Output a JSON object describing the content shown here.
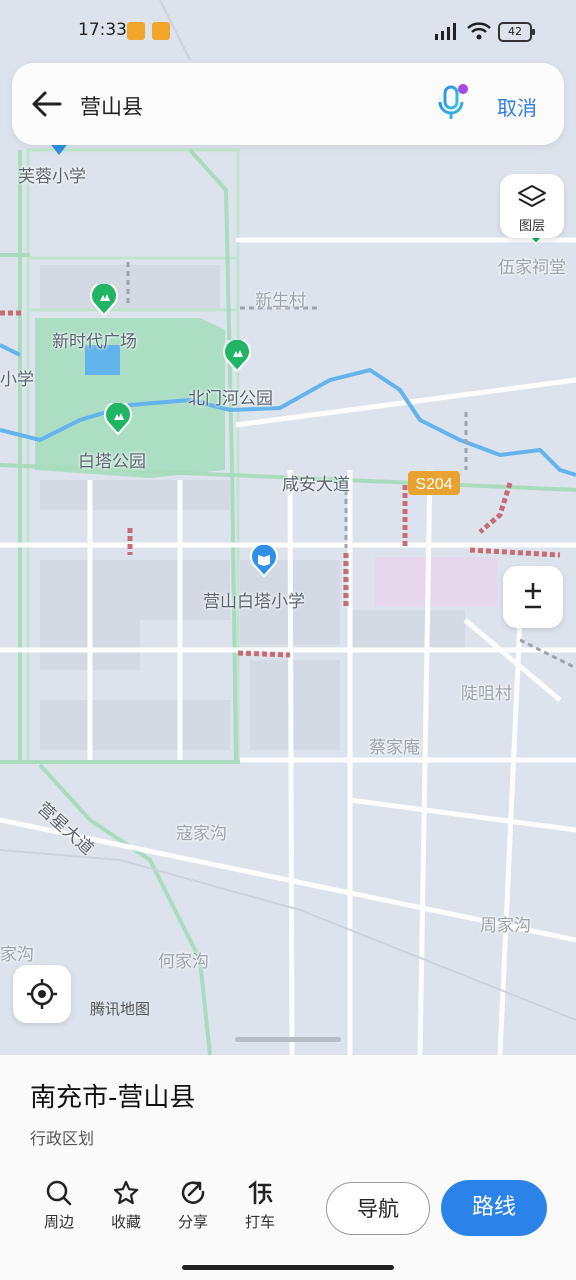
{
  "status_bar": {
    "time": "17:33",
    "battery": "42"
  },
  "search": {
    "query": "营山县",
    "cancel_label": "取消"
  },
  "map": {
    "labels": [
      {
        "text": "芙蓉小学",
        "style": "dark"
      },
      {
        "text": "新生村",
        "style": "light"
      },
      {
        "text": "新时代广场",
        "style": "dark"
      },
      {
        "text": "北门河公园",
        "style": "dark"
      },
      {
        "text": "白塔公园",
        "style": "dark"
      },
      {
        "text": "咸安大道",
        "style": "dark"
      },
      {
        "text": "营山白塔小学",
        "style": "dark"
      },
      {
        "text": "陡咀村",
        "style": "light"
      },
      {
        "text": "蔡家庵",
        "style": "light"
      },
      {
        "text": "营星大道",
        "style": "dark"
      },
      {
        "text": "寇家沟",
        "style": "light"
      },
      {
        "text": "周家沟",
        "style": "light"
      },
      {
        "text": "何家沟",
        "style": "light"
      },
      {
        "text": "家沟",
        "style": "light"
      },
      {
        "text": "伍家祠堂",
        "style": "light"
      },
      {
        "text": "小学",
        "style": "dark"
      }
    ],
    "road_badge": "S204",
    "layers_label": "图层",
    "watermark": "腾讯地图"
  },
  "place": {
    "name": "南充市-营山县",
    "category": "行政区划"
  },
  "actions": [
    {
      "label": "周边",
      "icon": "search-icon"
    },
    {
      "label": "收藏",
      "icon": "star-icon"
    },
    {
      "label": "分享",
      "icon": "share-icon"
    },
    {
      "label": "打车",
      "icon": "taxi-icon"
    }
  ],
  "buttons": {
    "navigate": "导航",
    "route": "路线"
  },
  "colors": {
    "accent": "#2b83ea",
    "park": "#9fdcb9",
    "water": "#63b3ec",
    "poi_green": "#1fb565",
    "poi_blue": "#2f8fe6"
  }
}
